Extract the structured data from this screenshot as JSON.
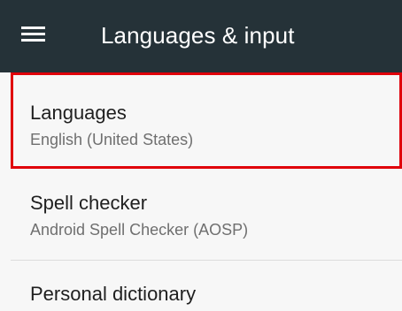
{
  "app_bar": {
    "title": "Languages & input",
    "menu_icon": "hamburger-menu-icon",
    "background_color": "#253238"
  },
  "preferences": [
    {
      "title": "Languages",
      "summary": "English (United States)",
      "highlighted": true
    },
    {
      "title": "Spell checker",
      "summary": "Android Spell Checker (AOSP)",
      "highlighted": false
    },
    {
      "title": "Personal dictionary",
      "summary": "",
      "highlighted": false
    }
  ],
  "colors": {
    "highlight_border": "#e0000a",
    "list_background": "#f7f7f7"
  }
}
